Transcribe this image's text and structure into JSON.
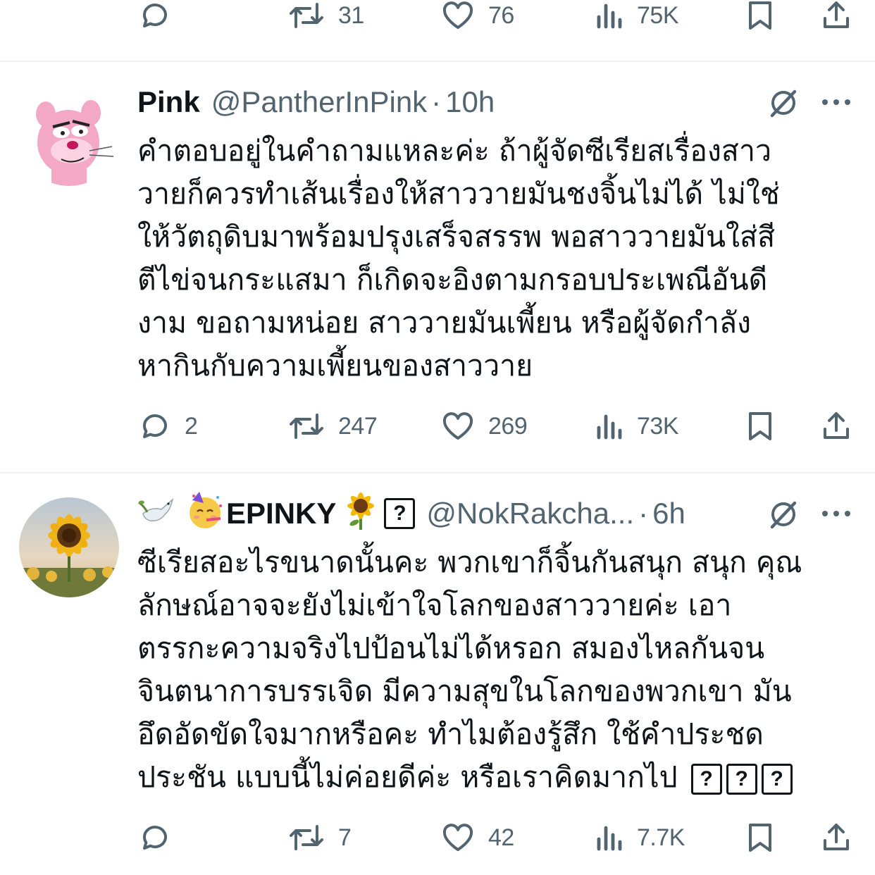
{
  "top_actions": {
    "replies": "",
    "retweets": "31",
    "likes": "76",
    "views": "75K"
  },
  "tweets": [
    {
      "name": "Pink",
      "handle": "@PantherInPink",
      "separator": "·",
      "time": "10h",
      "text_lines": [
        "คำตอบอยู่ในคำถามแหละค่ะ ถ้าผู้จัดซีเรียสเรื่องสาว",
        "วายก็ควรทำเส้นเรื่องให้สาววายมันชงจิ้นไม่ได้ ไม่ใช่",
        "ให้วัตถุดิบมาพร้อมปรุงเสร็จสรรพ พอสาววายมันใส่สี",
        "ตีไข่จนกระแสมา ก็เกิดจะอิงตามกรอบประเพณีอันดี",
        "งาม ขอถามหน่อย สาววายมันเพี้ยน หรือผู้จัดกำลัง",
        "หากินกับความเพี้ยนของสาววาย"
      ],
      "actions": {
        "replies": "2",
        "retweets": "247",
        "likes": "269",
        "views": "73K"
      }
    },
    {
      "name": "EPINKY",
      "unknown_glyph": "?",
      "handle": "@NokRakcha...",
      "separator": "·",
      "time": "6h",
      "text_lines": [
        "ซีเรียสอะไรขนาดนั้นคะ พวกเขาก็จิ้นกันสนุก สนุก คุณ",
        "ลักษณ์อาจจะยังไม่เข้าใจโลกของสาววายค่ะ เอา",
        "ตรรกะความจริงไปป้อนไม่ได้หรอก สมองไหลกันจน",
        "จินตนาการบรรเจิด มีความสุขในโลกของพวกเขา มัน",
        "อึดอัดขัดใจมากหรือคะ ทำไมต้องรู้สึก ใช้คำประชด",
        "ประชัน แบบนี้ไม่ค่อยดีค่ะ หรือเราคิดมากไป"
      ],
      "trailing_unknown_glyphs": [
        "?",
        "?",
        "?"
      ],
      "actions": {
        "replies": "",
        "retweets": "7",
        "likes": "42",
        "views": "7.7K"
      }
    }
  ],
  "icons": {
    "reply": "speech-bubble-icon",
    "retweet": "retweet-arrows-icon",
    "like": "heart-icon",
    "views": "bar-chart-icon",
    "bookmark": "bookmark-icon",
    "share": "share-upload-icon",
    "grok": "grok-slash-icon",
    "more": "three-dots-icon",
    "dove": "dove-emoji",
    "partying_face": "partying-face-emoji",
    "sunflower": "sunflower-emoji"
  },
  "colors": {
    "text": "#0f1419",
    "secondary": "#536471",
    "divider": "#eff3f4"
  }
}
